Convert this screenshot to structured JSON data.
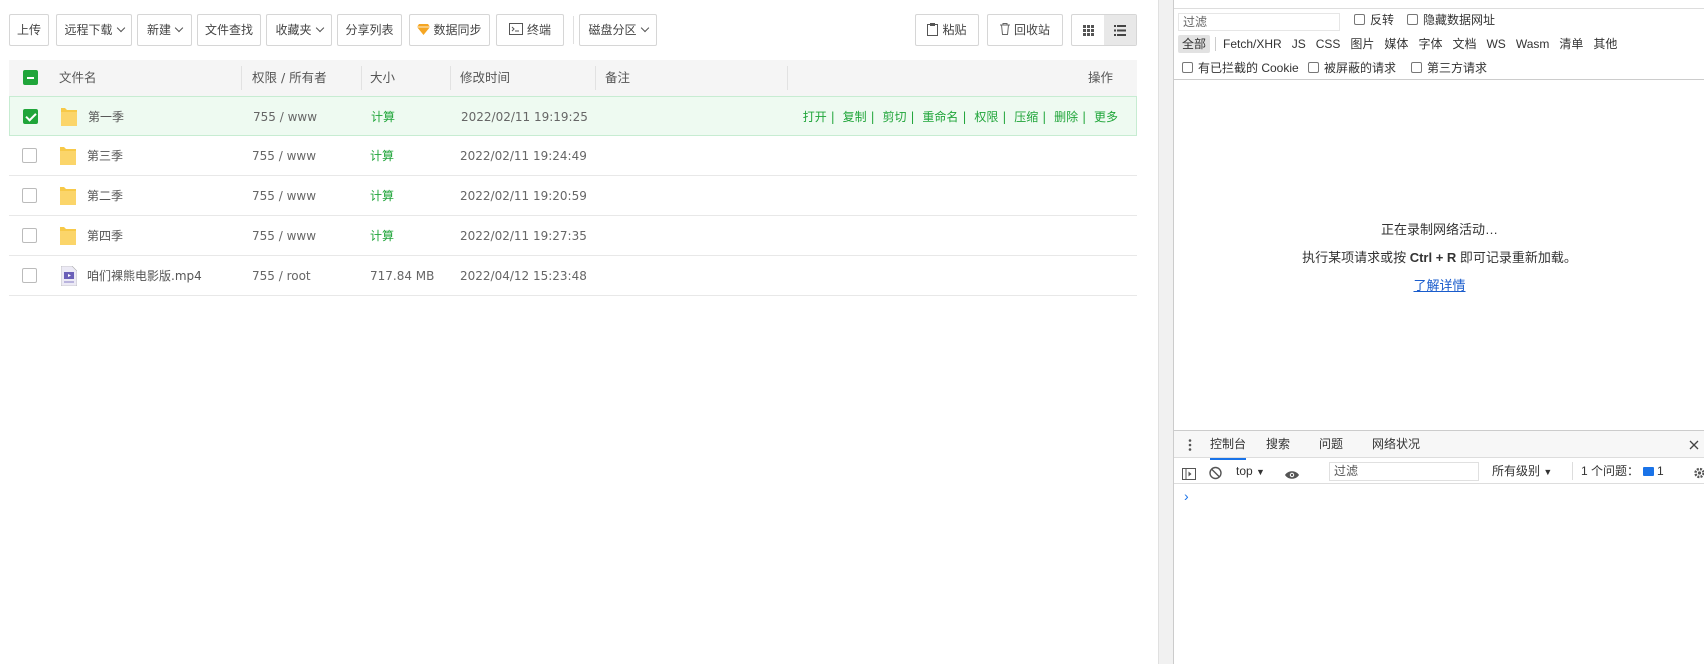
{
  "toolbar": {
    "upload": "上传",
    "remote_download": "远程下载",
    "new": "新建",
    "file_search": "文件查找",
    "favorites": "收藏夹",
    "share_list": "分享列表",
    "data_sync": "数据同步",
    "terminal": "终端",
    "disk_partition": "磁盘分区",
    "paste": "粘贴",
    "recycle_bin": "回收站"
  },
  "table": {
    "headers": {
      "name": "文件名",
      "perm_owner": "权限 / 所有者",
      "size": "大小",
      "modified": "修改时间",
      "remark": "备注",
      "actions": "操作"
    },
    "rows": [
      {
        "name": "第一季",
        "type": "folder",
        "perm": "755 / www",
        "size": "计算",
        "mtime": "2022/02/11 19:19:25",
        "selected": true
      },
      {
        "name": "第三季",
        "type": "folder",
        "perm": "755 / www",
        "size": "计算",
        "mtime": "2022/02/11 19:24:49",
        "selected": false
      },
      {
        "name": "第二季",
        "type": "folder",
        "perm": "755 / www",
        "size": "计算",
        "mtime": "2022/02/11 19:20:59",
        "selected": false
      },
      {
        "name": "第四季",
        "type": "folder",
        "perm": "755 / www",
        "size": "计算",
        "mtime": "2022/02/11 19:27:35",
        "selected": false
      },
      {
        "name": "咱们裸熊电影版.mp4",
        "type": "video",
        "perm": "755 / root",
        "size": "717.84 MB",
        "mtime": "2022/04/12 15:23:48",
        "selected": false
      }
    ],
    "row_actions": [
      "打开",
      "复制",
      "剪切",
      "重命名",
      "权限",
      "压缩",
      "删除",
      "更多"
    ]
  },
  "devtools": {
    "filter_placeholder": "过滤",
    "invert": "反转",
    "hide_data_urls": "隐藏数据网址",
    "type_filters": [
      "全部",
      "Fetch/XHR",
      "JS",
      "CSS",
      "图片",
      "媒体",
      "字体",
      "文档",
      "WS",
      "Wasm",
      "清单",
      "其他"
    ],
    "blocked_cookies": "有已拦截的 Cookie",
    "blocked_requests": "被屏蔽的请求",
    "third_party": "第三方请求",
    "recording": "正在录制网络活动…",
    "hint_pre": "执行某项请求或按 ",
    "hint_key": "Ctrl + R",
    "hint_post": " 即可记录重新加载。",
    "learn_more": "了解详情",
    "drawer_tabs": [
      "控制台",
      "搜索",
      "问题",
      "网络状况"
    ],
    "context": "top",
    "console_filter": "过滤",
    "levels": "所有级别",
    "issues": "1 个问题：",
    "issues_count": "1",
    "prompt": "›"
  },
  "colors": {
    "accent_green": "#20a53a",
    "devtools_blue": "#1a73e8",
    "folder_yellow": "#f7c948"
  }
}
